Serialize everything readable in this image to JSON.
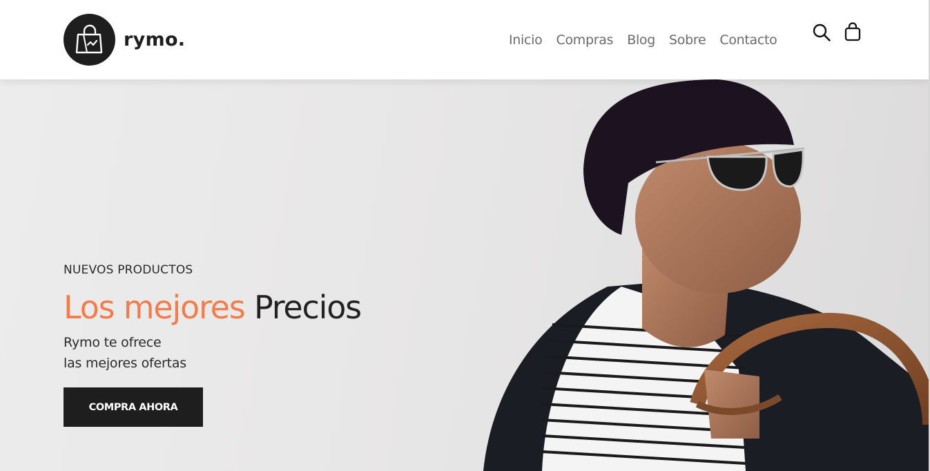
{
  "brand": {
    "name": "rymo.",
    "logo_icon": "shopping-bag-chart-icon",
    "logo_color": "#1e1e1e"
  },
  "nav": {
    "items": [
      {
        "label": "Inicio"
      },
      {
        "label": "Compras"
      },
      {
        "label": "Blog"
      },
      {
        "label": "Sobre"
      },
      {
        "label": "Contacto"
      }
    ],
    "search_icon": "search-icon",
    "cart_icon": "shopping-bag-icon"
  },
  "hero": {
    "eyebrow": "NUEVOS PRODUCTOS",
    "headline_accent": "Los mejores",
    "headline_rest": "Precios",
    "subtext_line1": "Rymo te ofrece",
    "subtext_line2": "las mejores ofertas",
    "cta_label": "COMPRA AHORA",
    "accent_color": "#f47c4b"
  }
}
